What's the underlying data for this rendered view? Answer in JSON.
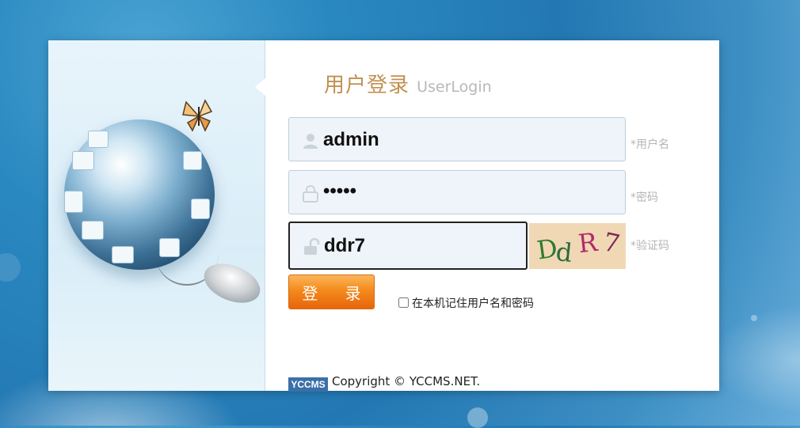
{
  "login": {
    "title_cn": "用户登录",
    "title_en": "UserLogin",
    "username": {
      "value": "admin",
      "hint": "*用户名",
      "icon": "user-icon"
    },
    "password": {
      "value": "•••••",
      "hint": "*密码",
      "icon": "lock-icon"
    },
    "captcha": {
      "value": "ddr7",
      "hint": "*验证码",
      "icon": "unlock-icon",
      "image_text": [
        "D",
        "d",
        "R",
        "7"
      ]
    },
    "submit_label": "登 录",
    "remember_label": "在本机记住用户名和密码",
    "remember_checked": false
  },
  "footer": {
    "logo_text": "YCCMS",
    "copyright": "Copyright © YCCMS.NET."
  },
  "colors": {
    "accent": "#f48a1c",
    "title": "#c2904f",
    "field_bg": "#eef4f9"
  }
}
